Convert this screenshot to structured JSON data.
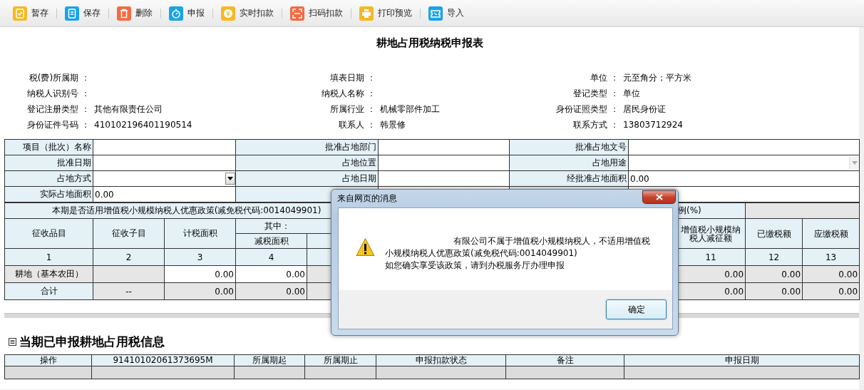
{
  "toolbar": [
    {
      "label": "暂存",
      "color": "#f5b921"
    },
    {
      "label": "保存",
      "color": "#1aa3e8"
    },
    {
      "label": "删除",
      "color": "#f26b43"
    },
    {
      "label": "申报",
      "color": "#1aa3e8"
    },
    {
      "label": "实时扣款",
      "color": "#f5b921"
    },
    {
      "label": "扫码扣款",
      "color": "#f26b43"
    },
    {
      "label": "打印预览",
      "color": "#f5b921"
    },
    {
      "label": "导入",
      "color": "#1aa3e8"
    }
  ],
  "title": "耕地占用税纳税申报表",
  "info": [
    [
      {
        "label": "税(费)所属期 ："
      },
      {
        "label": "填表日期 ："
      },
      {
        "label": "单位 ：",
        "value": "元至角分；平方米"
      }
    ],
    [
      {
        "label": "纳税人识别号 ："
      },
      {
        "label": "纳税人名称 ："
      },
      {
        "label": "登记类型 ：",
        "value": "单位"
      }
    ],
    [
      {
        "label": "登记注册类型 ：",
        "value": "其他有限责任公司"
      },
      {
        "label": "所属行业 ：",
        "value": "机械零部件加工"
      },
      {
        "label": "身份证照类型 ：",
        "value": "居民身份证"
      }
    ],
    [
      {
        "label": "身份证件号码 ：",
        "value": "410102196401190514"
      },
      {
        "label": "联系人 ：",
        "value": "韩景修"
      },
      {
        "label": "联系方式 ：",
        "value": "13803712924"
      }
    ]
  ],
  "approval_table": {
    "rows": [
      [
        {
          "kind": "label",
          "text": "项目（批次）名称"
        },
        {
          "kind": "input"
        },
        {
          "kind": "label",
          "text": "批准占地部门"
        },
        {
          "kind": "input"
        },
        {
          "kind": "label",
          "text": "批准占地文号"
        },
        {
          "kind": "input"
        }
      ],
      [
        {
          "kind": "label",
          "text": "批准日期"
        },
        {
          "kind": "input"
        },
        {
          "kind": "label",
          "text": "占地位置"
        },
        {
          "kind": "input"
        },
        {
          "kind": "label",
          "text": "占地用途"
        },
        {
          "kind": "select",
          "disabled": true
        }
      ],
      [
        {
          "kind": "label",
          "text": "占地方式"
        },
        {
          "kind": "select",
          "disabled": false
        },
        {
          "kind": "label",
          "text": "占地日期"
        },
        {
          "kind": "input"
        },
        {
          "kind": "label",
          "text": "经批准占地面积"
        },
        {
          "kind": "input",
          "text": "0.00"
        }
      ],
      [
        {
          "kind": "label",
          "text": "实际占地面积"
        },
        {
          "kind": "input",
          "text": "0.00"
        },
        {
          "kind": "covered"
        },
        {
          "kind": "covered"
        },
        {
          "kind": "covered"
        },
        {
          "kind": "covered"
        }
      ]
    ]
  },
  "tax_table": {
    "policy_question": "本期是否适用增值税小规模纳税人优惠政策(减免税代码:0014049901)",
    "ratio_label": "例(%)",
    "group_label": "其中：",
    "left_columns": [
      {
        "header": "征收品目",
        "number": "1"
      },
      {
        "header": "征收子目",
        "number": "2"
      },
      {
        "header": "计税面积",
        "number": "3"
      },
      {
        "header": "减税面积",
        "number": "4"
      }
    ],
    "right_columns": [
      {
        "header": "增值税小规模纳税人减征额",
        "number": "11"
      },
      {
        "header": "已缴税额",
        "number": "12"
      },
      {
        "header": "应缴税额",
        "number": "13"
      }
    ],
    "rows": [
      {
        "kind": "item",
        "left": [
          {
            "text": "耕地（基本农田）"
          },
          {
            "editable": false
          },
          {
            "text": "0.00",
            "editable": true
          },
          {
            "text": "0.00",
            "editable": true
          }
        ],
        "right": [
          {
            "text": "0.00",
            "editable": false
          },
          {
            "text": "0.00",
            "editable": false
          },
          {
            "text": "0.00",
            "editable": false
          }
        ]
      },
      {
        "kind": "total",
        "left": [
          {
            "text": "合计"
          },
          {
            "text": "--",
            "editable": false
          },
          {
            "text": "0.00",
            "editable": false
          },
          {
            "text": "0.00",
            "editable": false
          }
        ],
        "right": [
          {
            "text": "0.00",
            "editable": false
          },
          {
            "text": "0.00",
            "editable": false
          },
          {
            "text": "0.00",
            "editable": false
          }
        ]
      }
    ]
  },
  "records": {
    "heading": "当期已申报耕地占用税信息",
    "columns": [
      "操作",
      "91410102061373695M",
      "所属期起",
      "所属期止",
      "申报扣款状态",
      "备注",
      "申报日期"
    ]
  },
  "dialog": {
    "title": "来自网页的消息",
    "lines": [
      "有限公司不属于增值税小规模纳税人，不适用增值税",
      "小规模纳税人优惠政策(减免税代码:0014049901)",
      "如您确实享受该政策，请到办税服务厅办理申报"
    ],
    "ok": "确定"
  }
}
